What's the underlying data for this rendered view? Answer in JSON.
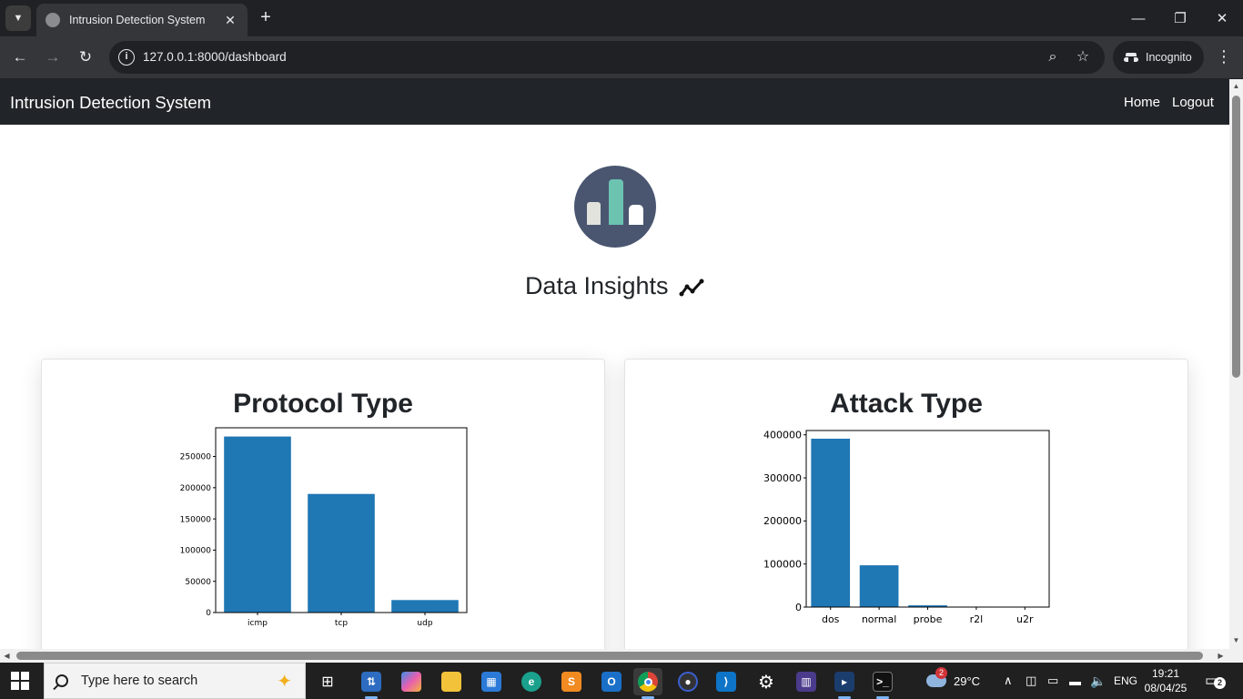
{
  "browser": {
    "tab_title": "Intrusion Detection System",
    "new_tab_glyph": "+",
    "close_glyph": "✕",
    "url": "127.0.0.1:8000/dashboard",
    "incognito_label": "Incognito",
    "icons": [
      "tab-search-icon",
      "close-icon",
      "new-tab-icon",
      "minimize-icon",
      "restore-icon",
      "back-icon",
      "forward-icon",
      "reload-icon",
      "site-info-icon",
      "zoom-icon",
      "bookmark-star-icon",
      "incognito-icon",
      "menu-icon"
    ]
  },
  "app": {
    "brand": "Intrusion Detection System",
    "nav": {
      "home": "Home",
      "logout": "Logout"
    },
    "hero_title": "Data Insights",
    "hero_colors": {
      "circle": "#4a5670",
      "bar_left": "#e1e3dc",
      "bar_center": "#6cc3b0",
      "bar_right": "#ffffff"
    },
    "cards": {
      "protocol_title": "Protocol Type",
      "attack_title": "Attack Type"
    }
  },
  "chart_data": [
    {
      "type": "bar",
      "categories": [
        "icmp",
        "tcp",
        "udp"
      ],
      "values": [
        282000,
        190000,
        20000
      ],
      "yticks": [
        0,
        50000,
        100000,
        150000,
        200000,
        250000
      ],
      "ylim": [
        0,
        296000
      ],
      "title": "Protocol Type",
      "color": "#1f77b4"
    },
    {
      "type": "bar",
      "categories": [
        "dos",
        "normal",
        "probe",
        "r2l",
        "u2r"
      ],
      "values": [
        391000,
        97000,
        4100,
        1100,
        50
      ],
      "yticks": [
        0,
        100000,
        200000,
        300000,
        400000
      ],
      "ylim": [
        0,
        410000
      ],
      "title": "Attack Type",
      "color": "#1f77b4"
    }
  ],
  "taskbar": {
    "search_placeholder": "Type here to search",
    "weather_temp": "29°C",
    "weather_badge": "2",
    "language": "ENG",
    "time": "19:21",
    "date": "08/04/25",
    "notification_count": "2",
    "icons": [
      "windows-start-icon",
      "search-icon",
      "copilot-icon",
      "task-view-icon",
      "network-app-icon",
      "copilot-app-icon",
      "file-explorer-icon",
      "microsoft-store-icon",
      "edge-icon",
      "sublime-text-icon",
      "outlook-icon",
      "chrome-icon",
      "anaconda-icon",
      "vscode-icon",
      "settings-icon",
      "chart-app-icon",
      "powershell-icon",
      "terminal-icon",
      "weather-icon",
      "tray-chevron-icon",
      "meet-icon",
      "display-icon",
      "battery-icon",
      "volume-icon",
      "notification-icon"
    ]
  }
}
